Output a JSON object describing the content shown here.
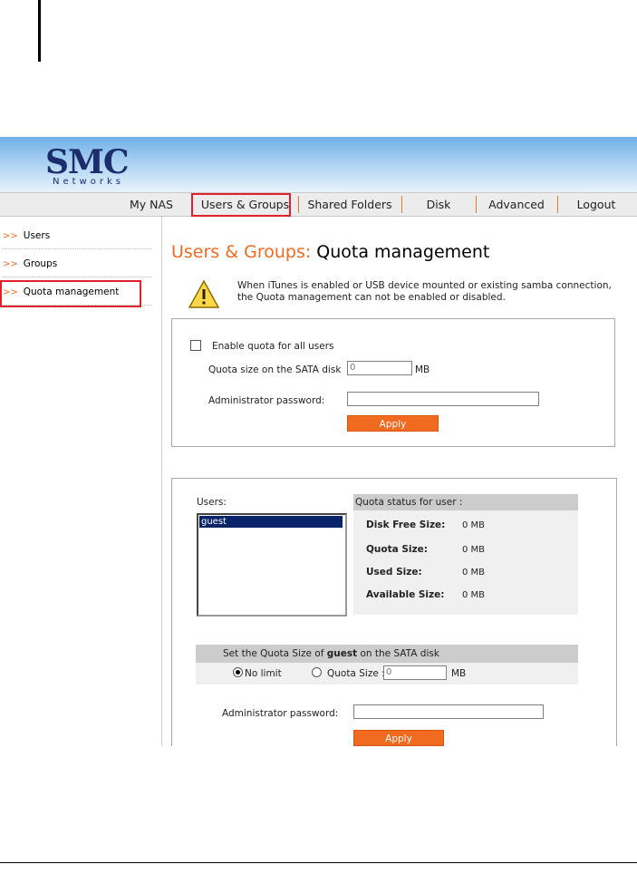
{
  "logo": {
    "brand": "SMC",
    "sub": "Networks"
  },
  "nav": {
    "items": [
      "My NAS",
      "Users & Groups",
      "Shared Folders",
      "Disk",
      "Advanced",
      "Logout"
    ]
  },
  "sidebar": {
    "arrow": ">>",
    "items": [
      "Users",
      "Groups",
      "Quota management"
    ]
  },
  "page": {
    "section": "Users & Groups:",
    "title": "Quota management",
    "warning": "When iTunes is enabled or USB device mounted or existing samba connection, the Quota management can not be enabled or disabled."
  },
  "quota_all": {
    "enable_label": "Enable quota for all users",
    "enabled": false,
    "size_label": "Quota size on the SATA disk",
    "size_value": "0",
    "unit": "MB",
    "password_label": "Administrator password:",
    "password_value": "",
    "apply": "Apply"
  },
  "user_quota": {
    "users_label": "Users:",
    "users": [
      "guest"
    ],
    "selected_user": "guest",
    "status_header": "Quota status for user :",
    "stats": [
      {
        "label": "Disk Free Size:",
        "value": "0 MB"
      },
      {
        "label": "Quota Size:",
        "value": "0 MB"
      },
      {
        "label": "Used Size:",
        "value": "0 MB"
      },
      {
        "label": "Available Size:",
        "value": "0 MB"
      }
    ],
    "set_prefix": "Set the Quota Size of ",
    "set_user": "guest",
    "set_suffix": " on the SATA disk",
    "no_limit": "No limit",
    "quota_size_label": "Quota Size :",
    "quota_size_value": "0",
    "unit": "MB",
    "selected_option": "No limit",
    "password_label": "Administrator password:",
    "password_value": "",
    "apply": "Apply"
  },
  "colors": {
    "accent": "#f06a20",
    "highlight": "#e0202a",
    "selection": "#0a246a"
  }
}
